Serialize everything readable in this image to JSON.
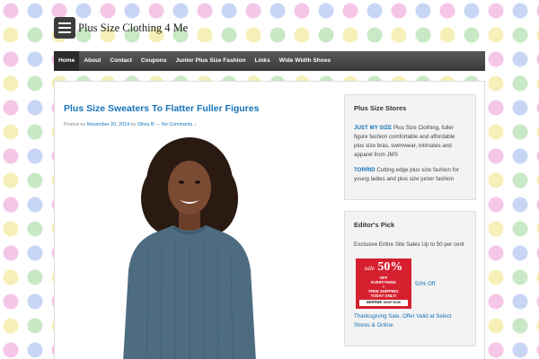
{
  "header": {
    "site_title": "Plus Size Clothing 4 Me",
    "menu_icon": "hamburger-menu-icon"
  },
  "nav": {
    "items": [
      {
        "label": "Home",
        "active": true
      },
      {
        "label": "About"
      },
      {
        "label": "Contact"
      },
      {
        "label": "Coupons"
      },
      {
        "label": "Junior Plus Size Fashion"
      },
      {
        "label": "Links"
      },
      {
        "label": "Wide Width Shoes"
      }
    ]
  },
  "post": {
    "title": "Plus Size Sweaters To Flatter Fuller Figures",
    "meta_posted": "Posted on",
    "date": "November 20, 2014",
    "meta_by": "by",
    "author": "Olivia B",
    "meta_sep": "—",
    "comments": "No Comments ↓"
  },
  "sidebar": {
    "stores": {
      "title": "Plus Size Stores",
      "jms_link": "JUST MY SIZE",
      "jms_text": "Plus Size Clothing, fuller figure fashion comfortable and affordable plus size bras, swimwear, intimates and apparel from JMS",
      "torrid_link": "TORRID",
      "torrid_text": "Cutting edge plus size fashion for young ladies and plus size junior fashion"
    },
    "editors_pick": {
      "title": "Editor's Pick",
      "text_before": "Exclusive Entire Site Sales Up to 50 per cent",
      "link_inline": "50% Off",
      "link_after": "Thanksgiving Sale. Offer Valid at Select Stores & Online.",
      "ad": {
        "sale": "sale",
        "pct": "50%",
        "off": "OFF",
        "everything": "EVERYTHING",
        "plus": "+",
        "shipping": "FREE SHIPPING",
        "today": "TODAY ONLY!",
        "brand": "avenue",
        "shop": "SHOP NOW"
      }
    }
  },
  "colors": {
    "link": "#1673b8",
    "nav_bg": "#3a3a3a",
    "ad_red": "#d6202f"
  }
}
